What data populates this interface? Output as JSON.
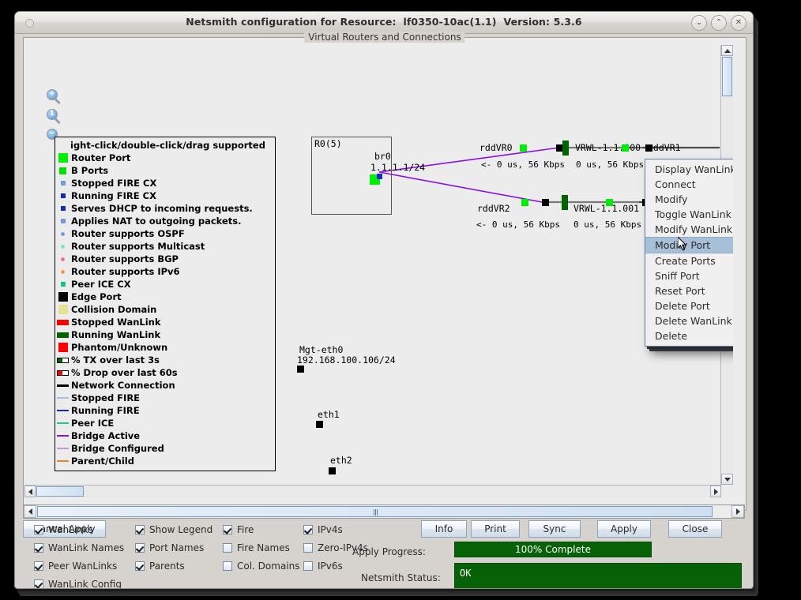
{
  "window": {
    "title": "Netsmith configuration for Resource:  lf0350-10ac(1.1)  Version: 5.3.6",
    "buttons": {
      "minimize": "⌄",
      "maximize": "⌃",
      "close": "✕"
    }
  },
  "canvas": {
    "group_title": "Virtual Routers and Connections",
    "zoom_tools": [
      {
        "name": "zoom-in-icon",
        "glyph": "+"
      },
      {
        "name": "zoom-actual-icon",
        "glyph": "1"
      },
      {
        "name": "zoom-out-icon",
        "glyph": "−"
      }
    ]
  },
  "legend": {
    "header": "ight-click/double-click/drag supported",
    "items": [
      {
        "label": "Router Port",
        "swatch": "square-large",
        "color": "#00ee00"
      },
      {
        "label": "B Ports",
        "swatch": "square-med",
        "color": "#00e000"
      },
      {
        "label": "Stopped FIRE CX",
        "swatch": "square-sm",
        "color": "#6d9ee0"
      },
      {
        "label": "Running FIRE CX",
        "swatch": "square-sm",
        "color": "#1528c8"
      },
      {
        "label": "Serves DHCP to incoming requests.",
        "swatch": "square-sm",
        "color": "#1528c8"
      },
      {
        "label": "Applies NAT to outgoing packets.",
        "swatch": "square-sm",
        "color": "#6d9ee0"
      },
      {
        "label": "Router supports OSPF",
        "swatch": "dot",
        "color": "#6f9ede"
      },
      {
        "label": "Router supports Multicast",
        "swatch": "dot",
        "color": "#7ee8b0"
      },
      {
        "label": "Router supports BGP",
        "swatch": "dot",
        "color": "#f2708c"
      },
      {
        "label": "Router supports IPv6",
        "swatch": "dot",
        "color": "#f5994f"
      },
      {
        "label": "Peer ICE CX",
        "swatch": "square-sm",
        "color": "#12c48d"
      },
      {
        "label": "Edge Port",
        "swatch": "square-large",
        "color": "#000000"
      },
      {
        "label": "Collision Domain",
        "swatch": "square-large",
        "color": "#e3e398"
      },
      {
        "label": "Stopped WanLink",
        "swatch": "bar",
        "color": "#ff0000"
      },
      {
        "label": "Running WanLink",
        "swatch": "bar",
        "color": "#006400"
      },
      {
        "label": "Phantom/Unknown",
        "swatch": "square-large",
        "color": "#ff0000"
      },
      {
        "label": "% TX over last 3s",
        "swatch": "bar-split",
        "color": "#006400"
      },
      {
        "label": "% Drop over last 60s",
        "swatch": "bar-split",
        "color": "#ff0000"
      },
      {
        "label": "Network Connection",
        "swatch": "line-thick",
        "color": "#000000"
      },
      {
        "label": "Stopped FIRE",
        "swatch": "line",
        "color": "#9dc4ef"
      },
      {
        "label": "Running FIRE",
        "swatch": "line",
        "color": "#1528c8"
      },
      {
        "label": "Peer ICE",
        "swatch": "line",
        "color": "#18c99a"
      },
      {
        "label": "Bridge Active",
        "swatch": "line",
        "color": "#8a10e8"
      },
      {
        "label": "Bridge Configured",
        "swatch": "line",
        "color": "#d093c8"
      },
      {
        "label": "Parent/Child",
        "swatch": "line",
        "color": "#f5852a"
      }
    ]
  },
  "diagram": {
    "router_box": {
      "label": "R0(5)"
    },
    "br0": {
      "name": "br0",
      "ip": "1.1.1.1/24"
    },
    "links": [
      {
        "vr_name": "rddVR0",
        "vr_stats": "<- 0 us, 56 Kbps",
        "wanlink_name": "VRWL-1.1.000",
        "wanlink_stats": "0 us, 56 Kbps -",
        "endpoint_name": "rddVR1"
      },
      {
        "vr_name": "rddVR2",
        "vr_stats": "<- 0 us, 56 Kbps",
        "wanlink_name": "VRWL-1.1.001",
        "wanlink_stats": "0 us, 56 Kbps -",
        "endpoint_name": ""
      }
    ],
    "free_ports": [
      {
        "name": "Mgt-eth0",
        "ip": "192.168.100.106/24"
      },
      {
        "name": "eth1",
        "ip": ""
      },
      {
        "name": "eth2",
        "ip": ""
      }
    ],
    "colors": {
      "bridge_active": "#8a10e8",
      "network_connection": "#777777",
      "port": "#00ee00",
      "edge": "#000000",
      "wanlink_running": "#006400"
    }
  },
  "context_menu": {
    "items": [
      {
        "label": "Display WanLink & WanPaths",
        "selected": false
      },
      {
        "label": "Connect",
        "selected": false
      },
      {
        "label": "Modify",
        "selected": false
      },
      {
        "label": "Toggle WanLink",
        "selected": false
      },
      {
        "label": "Modify WanLink",
        "selected": false
      },
      {
        "label": "Modify Port",
        "selected": true
      },
      {
        "label": "Create Ports",
        "selected": false
      },
      {
        "label": "Sniff Port",
        "selected": false
      },
      {
        "label": "Reset Port",
        "selected": false
      },
      {
        "label": "Delete Port",
        "selected": false
      },
      {
        "label": "Delete WanLink",
        "selected": false
      },
      {
        "label": "Delete",
        "selected": false
      }
    ],
    "highlight_color": "#a8bfd8"
  },
  "controls": {
    "checkbox_columns": [
      [
        {
          "label": "WanLinks",
          "checked": true
        },
        {
          "label": "WanLink Names",
          "checked": true
        },
        {
          "label": "Peer WanLinks",
          "checked": true
        },
        {
          "label": "WanLink Config",
          "checked": true
        }
      ],
      [
        {
          "label": "Show Legend",
          "checked": true
        },
        {
          "label": "Port Names",
          "checked": true
        },
        {
          "label": "Parents",
          "checked": true
        }
      ],
      [
        {
          "label": "Fire",
          "checked": true
        },
        {
          "label": "Fire Names",
          "checked": false
        },
        {
          "label": "Col. Domains",
          "checked": false
        }
      ],
      [
        {
          "label": "IPv4s",
          "checked": true
        },
        {
          "label": "Zero-IPv4s",
          "checked": false
        },
        {
          "label": "IPv6s",
          "checked": false
        }
      ]
    ],
    "buttons": [
      "Info",
      "Print",
      "Sync",
      "Apply",
      "Close"
    ],
    "cancel_apply": "Cancel Apply",
    "apply_progress_label": "Apply Progress:",
    "apply_progress_value": "100% Complete",
    "status_label": "Netsmith Status:",
    "status_value": "OK",
    "status_color": "#076107"
  }
}
